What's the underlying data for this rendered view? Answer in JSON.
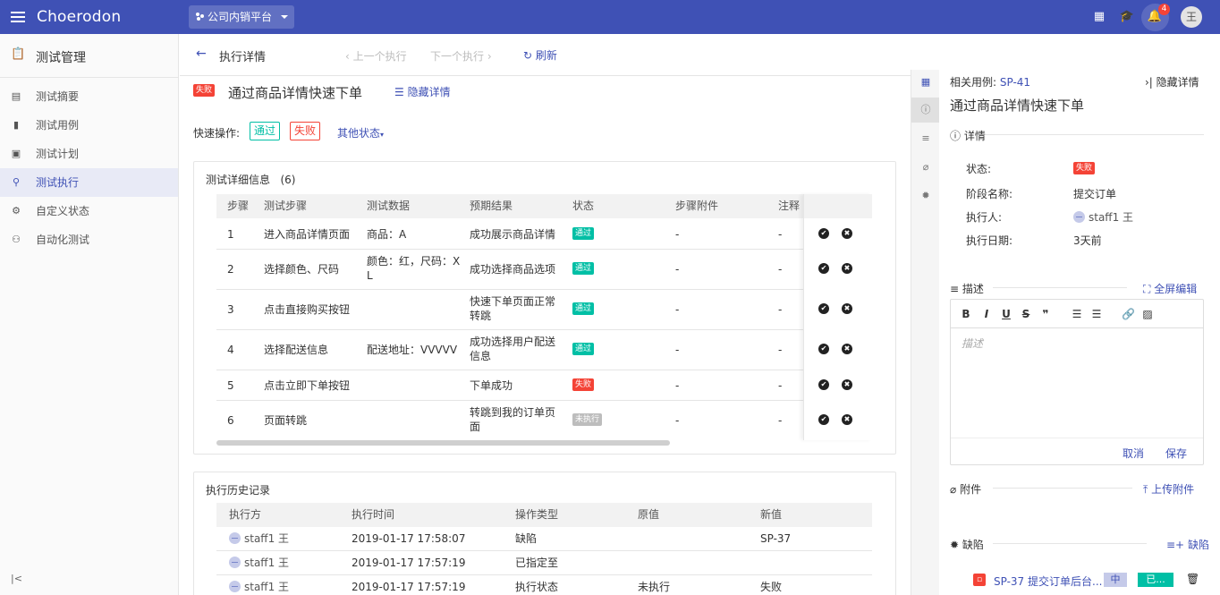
{
  "app": {
    "brand": "Choerodon",
    "project": "公司内销平台",
    "notification_count": "4",
    "user_initial": "王"
  },
  "sidebar": {
    "header": "测试管理",
    "items": [
      {
        "label": "测试摘要",
        "icon": "table-icon"
      },
      {
        "label": "测试用例",
        "icon": "file-icon"
      },
      {
        "label": "测试计划",
        "icon": "calendar-icon"
      },
      {
        "label": "测试执行",
        "icon": "search-icon",
        "active": true
      },
      {
        "label": "自定义状态",
        "icon": "gear-icon"
      },
      {
        "label": "自动化测试",
        "icon": "robot-icon"
      }
    ],
    "collapse": "|<"
  },
  "subbar": {
    "title": "执行详情",
    "prev": "上一个执行",
    "next": "下一个执行",
    "refresh": "刷新"
  },
  "main": {
    "status": "失败",
    "case_title": "通过商品详情快速下单",
    "hide_detail": "隐藏详情",
    "quick_label": "快速操作:",
    "quick_pass": "通过",
    "quick_fail": "失败",
    "other_status": "其他状态",
    "steps_title": "测试详细信息",
    "steps_count": "(6)",
    "steps_headers": [
      "步骤",
      "测试步骤",
      "测试数据",
      "预期结果",
      "状态",
      "步骤附件",
      "注释"
    ],
    "steps": [
      {
        "no": "1",
        "step": "进入商品详情页面",
        "data": "商品：A",
        "expected": "成功展示商品详情",
        "status": "通过",
        "attach": "-",
        "note": "-"
      },
      {
        "no": "2",
        "step": "选择颜色、尺码",
        "data": "颜色：红，尺码：XL",
        "expected": "成功选择商品选项",
        "status": "通过",
        "attach": "-",
        "note": "-"
      },
      {
        "no": "3",
        "step": "点击直接购买按钮",
        "data": "",
        "expected": "快速下单页面正常转跳",
        "status": "通过",
        "attach": "-",
        "note": "-"
      },
      {
        "no": "4",
        "step": "选择配送信息",
        "data": "配送地址：VVVVV",
        "expected": "成功选择用户配送信息",
        "status": "通过",
        "attach": "-",
        "note": "-"
      },
      {
        "no": "5",
        "step": "点击立即下单按钮",
        "data": "",
        "expected": "下单成功",
        "status": "失败",
        "attach": "-",
        "note": "-"
      },
      {
        "no": "6",
        "step": "页面转跳",
        "data": "",
        "expected": "转跳到我的订单页面",
        "status": "未执行",
        "attach": "-",
        "note": "-"
      }
    ],
    "history_title": "执行历史记录",
    "history_headers": [
      "执行方",
      "执行时间",
      "操作类型",
      "原值",
      "新值"
    ],
    "history": [
      {
        "user": "staff1 王",
        "time": "2019-01-17 17:58:07",
        "type": "缺陷",
        "old": "",
        "new": "SP-37"
      },
      {
        "user": "staff1 王",
        "time": "2019-01-17 17:57:19",
        "type": "已指定至",
        "old": "",
        "new": ""
      },
      {
        "user": "staff1 王",
        "time": "2019-01-17 17:57:19",
        "type": "执行状态",
        "old": "未执行",
        "new": "失败"
      }
    ]
  },
  "panel": {
    "related_label": "相关用例:",
    "related_id": "SP-41",
    "hide": "隐藏详情",
    "title": "通过商品详情快速下单",
    "details_section": "详情",
    "fields": [
      {
        "label": "状态:",
        "value": "失败"
      },
      {
        "label": "阶段名称:",
        "value": "提交订单"
      },
      {
        "label": "执行人:",
        "value": "staff1 王"
      },
      {
        "label": "执行日期:",
        "value": "3天前"
      }
    ],
    "desc_section": "描述",
    "fullscreen": "全屏编辑",
    "placeholder": "描述",
    "cancel": "取消",
    "save": "保存",
    "attach_section": "附件",
    "upload": "上传附件",
    "defect_section": "缺陷",
    "defect_link": "缺陷",
    "defect": {
      "text": "SP-37 提交订单后台...",
      "priority": "中",
      "status": "已..."
    }
  },
  "colors": {
    "primary": "#3f51b5",
    "pass": "#00bfa5",
    "fail": "#f44336",
    "pending": "#bdbdbd"
  }
}
